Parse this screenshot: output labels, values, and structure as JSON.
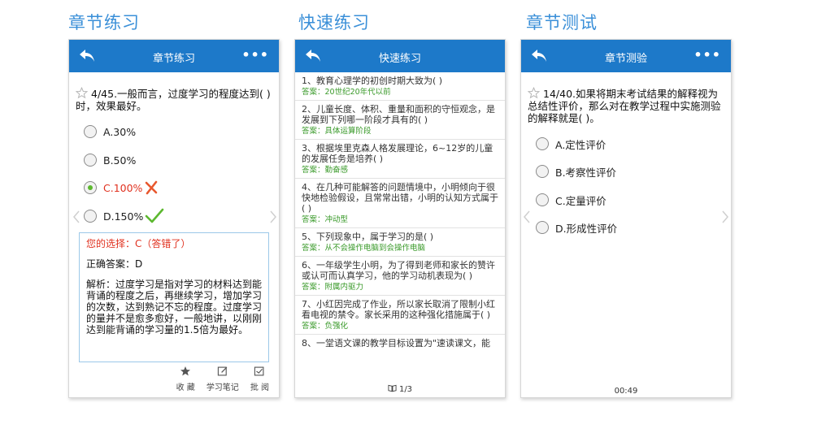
{
  "sections": {
    "chapter_practice": "章节练习",
    "quick_practice": "快速练习",
    "chapter_test": "章节测试"
  },
  "colors": {
    "accent": "#1d79c9",
    "title": "#3a8fd8",
    "wrong": "#e0301e",
    "correct": "#5cb82f",
    "answer": "#3a9a2a"
  },
  "phone1": {
    "title": "章节练习",
    "more": "•••",
    "question": "4/45.一般而言，过度学习的程度达到(  )时，效果最好。",
    "options": [
      "A.30%",
      "B.50%",
      "C.100%",
      "D.150%"
    ],
    "selected_index": 2,
    "your_choice": "您的选择：C（答错了）",
    "correct_answer": "正确答案：D",
    "analysis": "解析：过度学习是指对学习的材料达到能背诵的程度之后，再继续学习，增加学习的次数，达到熟记不忘的程度。过度学习的量并不是愈多愈好，一般地讲，以刚刚达到能背诵的学习量的1.5倍为最好。",
    "tools": [
      "收  藏",
      "学习笔记",
      "批  阅"
    ]
  },
  "phone2": {
    "title": "快速练习",
    "more": "•••",
    "items": [
      {
        "q": "1、教育心理学的初创时期大致为(  )",
        "a": "答案：20世纪20年代以前"
      },
      {
        "q": "2、儿童长度、体积、重量和面积的守恒观念，是发展到下列哪一阶段才具有的(  )",
        "a": "答案：具体运算阶段"
      },
      {
        "q": "3、根据埃里克森人格发展理论，6~12岁的儿童的发展任务是培养(  )",
        "a": "答案：勤奋感"
      },
      {
        "q": "4、在几种可能解答的问题情境中，小明倾向于很快地检验假设，且常常出错，小明的认知方式属于(  )",
        "a": "答案：冲动型"
      },
      {
        "q": "5、下列现象中，属于学习的是(  )",
        "a": "答案：从不会操作电脑到会操作电脑"
      },
      {
        "q": "6、一年级学生小明，为了得到老师和家长的赞许或认可而认真学习，他的学习动机表现为(  )",
        "a": "答案：附属内驱力"
      },
      {
        "q": "7、小红因完成了作业，所以家长取消了限制小红看电视的禁令。家长采用的这种强化措施属于(  )",
        "a": "答案：负强化"
      },
      {
        "q": "8、一堂语文课的教学目标设置为\"速读课文，能",
        "a": ""
      }
    ],
    "pager": "1/3"
  },
  "phone3": {
    "title": "章节测验",
    "more": "•••",
    "question": "14/40.如果将期末考试结果的解释视为总结性评价，那么对在教学过程中实施测验的解释就是(   )。",
    "options": [
      "A.定性评价",
      "B.考察性评价",
      "C.定量评价",
      "D.形成性评价"
    ],
    "timer": "00:49"
  }
}
